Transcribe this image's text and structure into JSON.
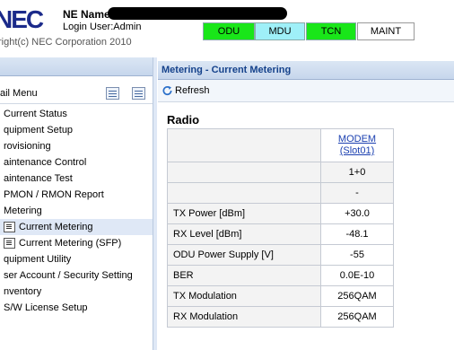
{
  "header": {
    "logo": "NEC",
    "ne_name_label": "NE Name:",
    "login_user": "Login User:Admin",
    "copyright": "right(c) NEC Corporation 2010",
    "buttons": {
      "odu": "ODU",
      "mdu": "MDU",
      "tcn": "TCN",
      "maint": "MAINT"
    },
    "colors": {
      "ok_green": "#19e619",
      "mdu_cyan": "#9ff0f8"
    }
  },
  "left_panel": {
    "title": "",
    "subtitle": "ail Menu",
    "items": [
      {
        "label": "Current Status",
        "icon": "",
        "selected": false
      },
      {
        "label": "quipment Setup",
        "icon": "",
        "selected": false
      },
      {
        "label": "rovisioning",
        "icon": "",
        "selected": false
      },
      {
        "label": "aintenance Control",
        "icon": "",
        "selected": false
      },
      {
        "label": "aintenance Test",
        "icon": "",
        "selected": false
      },
      {
        "label": "PMON / RMON Report",
        "icon": "",
        "selected": false
      },
      {
        "label": "Metering",
        "icon": "",
        "selected": false
      },
      {
        "label": "Current Metering",
        "icon": "list-icon",
        "selected": true
      },
      {
        "label": "Current Metering (SFP)",
        "icon": "list-icon",
        "selected": false
      },
      {
        "label": "quipment Utility",
        "icon": "",
        "selected": false
      },
      {
        "label": "ser Account / Security Setting",
        "icon": "",
        "selected": false
      },
      {
        "label": "nventory",
        "icon": "",
        "selected": false
      },
      {
        "label": "S/W License Setup",
        "icon": "",
        "selected": false
      }
    ]
  },
  "right_panel": {
    "title": "Metering - Current Metering",
    "refresh_label": "Refresh",
    "section_title": "Radio",
    "table": {
      "header": {
        "line1": "MODEM",
        "line2": "(Slot01)"
      },
      "subheader1": "1+0",
      "subheader2": "-",
      "rows": [
        {
          "label": "TX Power [dBm]",
          "value": "+30.0"
        },
        {
          "label": "RX Level [dBm]",
          "value": "-48.1"
        },
        {
          "label": "ODU Power Supply [V]",
          "value": "-55"
        },
        {
          "label": "BER",
          "value": "0.0E-10"
        },
        {
          "label": "TX Modulation",
          "value": "256QAM"
        },
        {
          "label": "RX Modulation",
          "value": "256QAM"
        }
      ]
    }
  }
}
